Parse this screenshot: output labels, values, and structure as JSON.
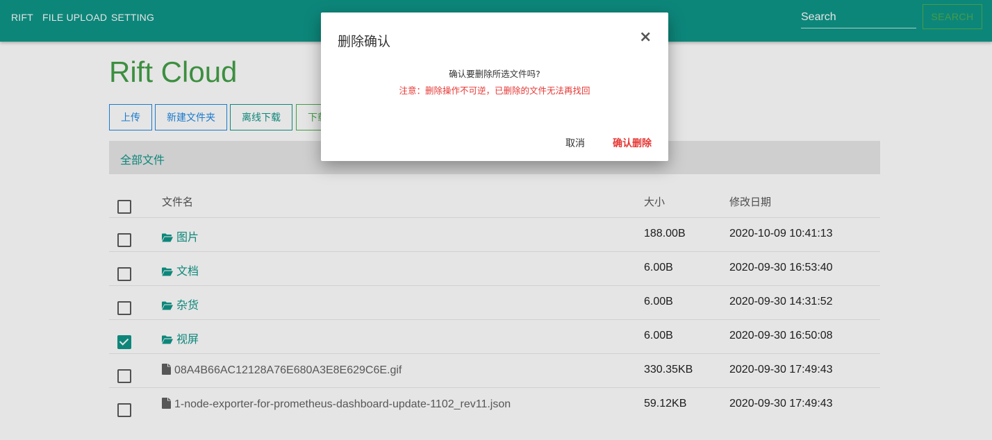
{
  "nav": {
    "brand": "RIFT",
    "items": [
      "FILE UPLOAD",
      "SETTING"
    ]
  },
  "search": {
    "placeholder": "Search",
    "button_label": "SEARCH"
  },
  "page": {
    "title": "Rift Cloud"
  },
  "toolbar": {
    "upload_label": "上传",
    "new_folder_label": "新建文件夹",
    "offline_download_label": "离线下载",
    "download_label": "下载"
  },
  "breadcrumb": {
    "label": "全部文件"
  },
  "table": {
    "headers": {
      "name": "文件名",
      "size": "大小",
      "date": "修改日期"
    },
    "rows": [
      {
        "type": "folder",
        "name": "图片",
        "size": "188.00B",
        "date": "2020-10-09 10:41:13",
        "checked": false
      },
      {
        "type": "folder",
        "name": "文档",
        "size": "6.00B",
        "date": "2020-09-30 16:53:40",
        "checked": false
      },
      {
        "type": "folder",
        "name": "杂货",
        "size": "6.00B",
        "date": "2020-09-30 14:31:52",
        "checked": false
      },
      {
        "type": "folder",
        "name": "视屏",
        "size": "6.00B",
        "date": "2020-09-30 16:50:08",
        "checked": true
      },
      {
        "type": "file",
        "name": "08A4B66AC12128A76E680A3E8E629C6E.gif",
        "size": "330.35KB",
        "date": "2020-09-30 17:49:43",
        "checked": false
      },
      {
        "type": "file",
        "name": "1-node-exporter-for-prometheus-dashboard-update-1102_rev11.json",
        "size": "59.12KB",
        "date": "2020-09-30 17:49:43",
        "checked": false
      }
    ]
  },
  "modal": {
    "title": "删除确认",
    "close_symbol": "×",
    "question": "确认要删除所选文件吗?",
    "warning": "注意：删除操作不可逆，已删除的文件无法再找回",
    "cancel_label": "取消",
    "confirm_label": "确认删除"
  },
  "colors": {
    "primary": "#0f9688",
    "title_green": "#43a047",
    "accent_blue": "#1e88e5",
    "danger": "#e53935"
  },
  "icons": {
    "folder": "folder-open-icon",
    "file": "file-icon",
    "checked": "checkbox-checked-icon",
    "unchecked": "checkbox-unchecked-icon"
  }
}
